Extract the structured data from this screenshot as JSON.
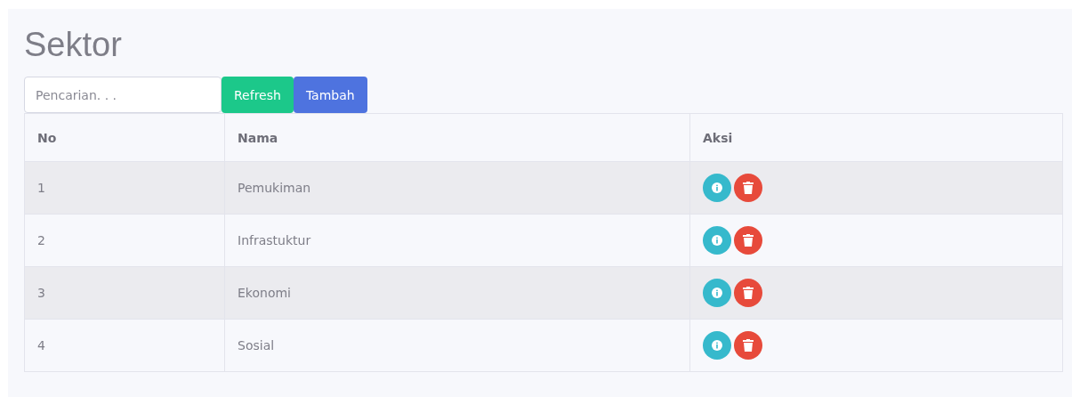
{
  "title": "Sektor",
  "search": {
    "placeholder": "Pencarian. . ."
  },
  "buttons": [
    {
      "label": "Refresh",
      "kind": "refresh"
    },
    {
      "label": "Tambah",
      "kind": "add"
    }
  ],
  "table": {
    "columns": [
      "No",
      "Nama",
      "Aksi"
    ],
    "rows": [
      {
        "no": "1",
        "nama": "Pemukiman"
      },
      {
        "no": "2",
        "nama": "Infrastuktur"
      },
      {
        "no": "3",
        "nama": "Ekonomi"
      },
      {
        "no": "4",
        "nama": "Sosial"
      }
    ]
  }
}
